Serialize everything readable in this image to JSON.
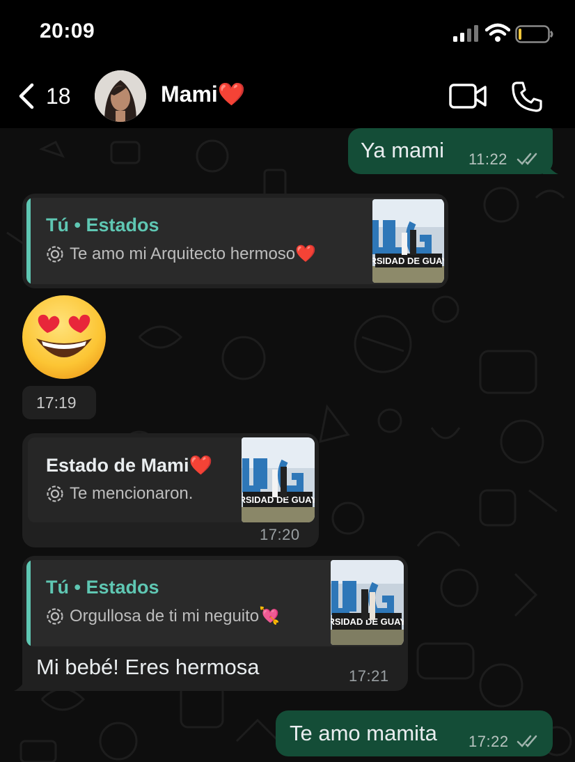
{
  "status_bar": {
    "time": "20:09"
  },
  "header": {
    "back_count": "18",
    "contact_name": "Mami",
    "contact_emoji": "❤️"
  },
  "messages": [
    {
      "direction": "outgoing",
      "text": "Ya mami",
      "time": "11:22",
      "read": true
    },
    {
      "direction": "incoming",
      "quote": {
        "title": "Tú • Estados",
        "subtitle": "Te amo mi Arquitecto hermoso",
        "subtitle_emoji": "❤️",
        "thumb_label": "UNIVERSIDAD DE GUAYAQUIL"
      },
      "emoji": "😍",
      "time": "17:19"
    },
    {
      "direction": "incoming",
      "quote": {
        "title": "Estado de Mami",
        "title_emoji": "❤️",
        "subtitle": "Te mencionaron.",
        "thumb_label": "UNIVERSIDAD DE GUAYAQUIL"
      },
      "time": "17:20"
    },
    {
      "direction": "incoming",
      "quote": {
        "title": "Tú • Estados",
        "subtitle": "Orgullosa de ti mi neguito",
        "subtitle_emoji": "💘",
        "thumb_label": "UNIVERSIDAD DE GUAYAQUIL"
      },
      "text": "Mi bebé! Eres hermosa",
      "time": "17:21"
    },
    {
      "direction": "outgoing",
      "text": "Te amo mamita",
      "time": "17:22",
      "read": true
    }
  ],
  "icons": [
    "back-chevron-icon",
    "video-call-icon",
    "phone-call-icon",
    "status-ring-icon",
    "double-check-icon"
  ],
  "colors": {
    "outgoing_bubble": "#144d37",
    "incoming_bubble": "#202020",
    "accent": "#5fc7b3"
  }
}
